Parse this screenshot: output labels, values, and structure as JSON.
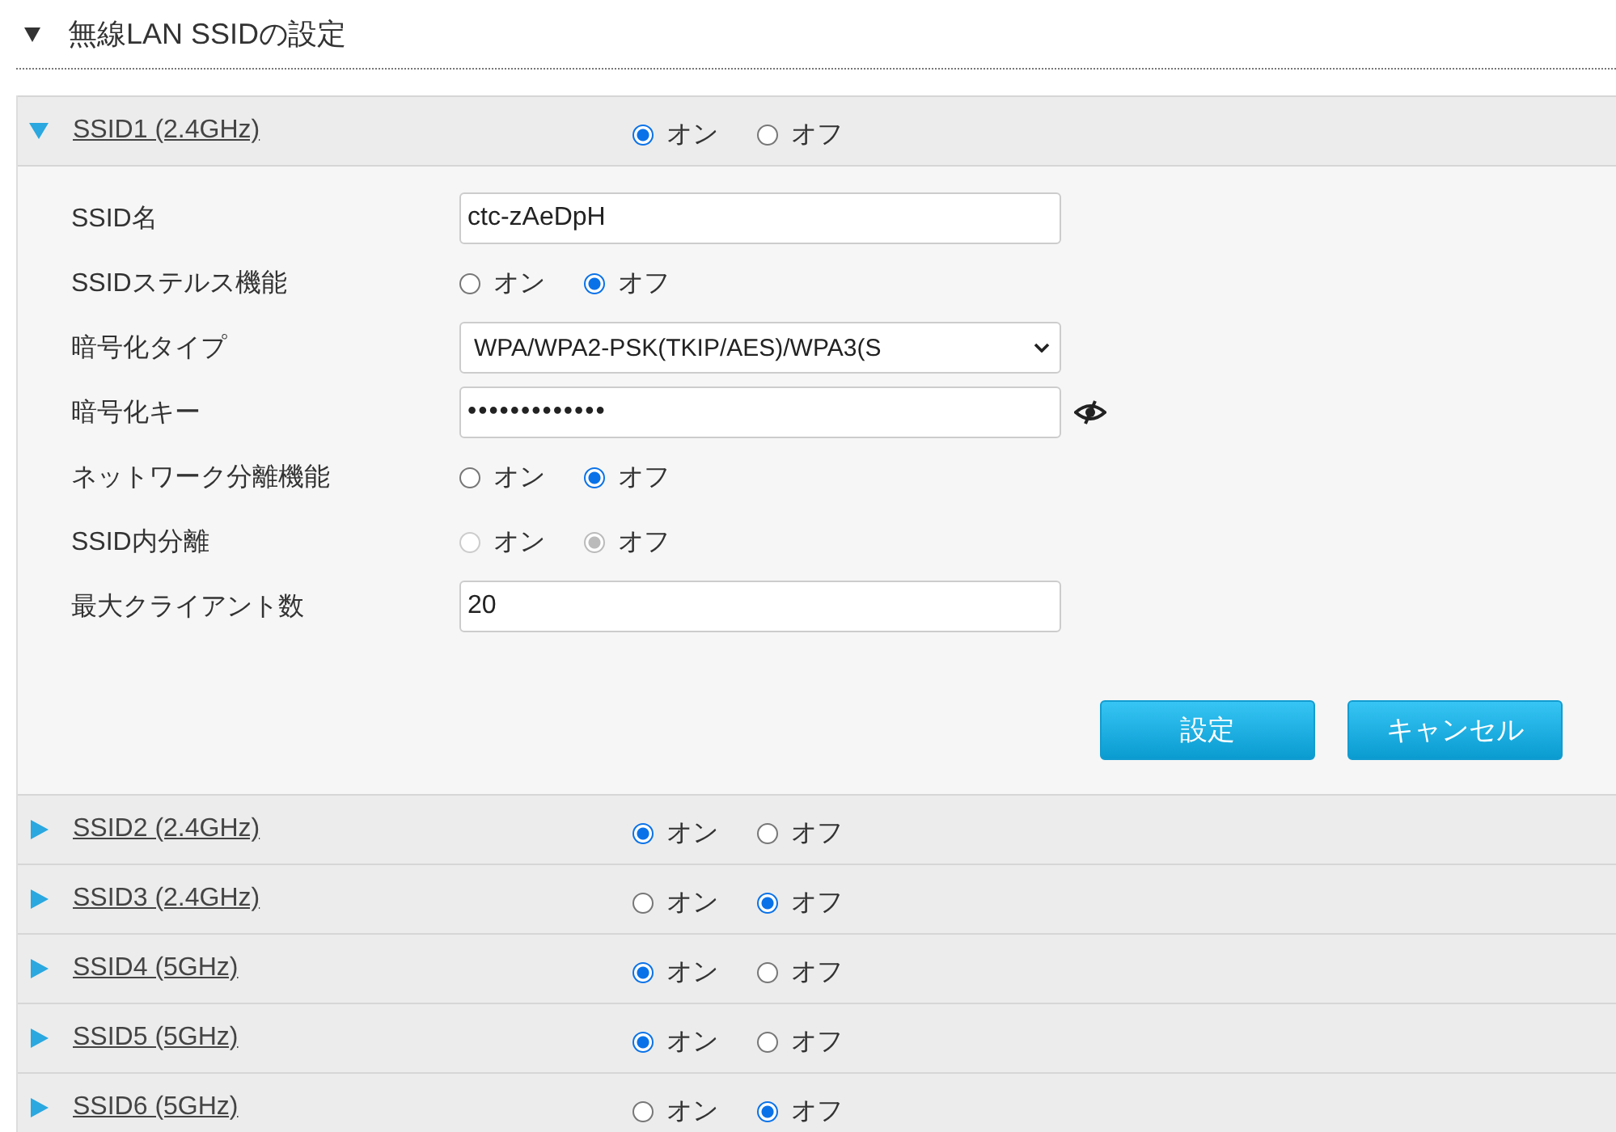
{
  "header": {
    "title": "無線LAN SSIDの設定",
    "expanded": true
  },
  "sections": [
    {
      "name": "SSID1 (2.4GHz)",
      "expanded": true,
      "options": [
        {
          "label": "オン",
          "selected": true
        },
        {
          "label": "オフ",
          "selected": false
        }
      ],
      "fields": [
        {
          "kind": "text",
          "label": "SSID名",
          "value": "ctc-zAeDpH"
        },
        {
          "kind": "radio",
          "label": "SSIDステルス機能",
          "disabled": false,
          "options": [
            {
              "label": "オン",
              "selected": false
            },
            {
              "label": "オフ",
              "selected": true
            }
          ]
        },
        {
          "kind": "select",
          "label": "暗号化タイプ",
          "value": "WPA/WPA2-PSK(TKIP/AES)/WPA3(S"
        },
        {
          "kind": "password",
          "label": "暗号化キー",
          "value": "•••••••••••••"
        },
        {
          "kind": "radio",
          "label": "ネットワーク分離機能",
          "disabled": false,
          "options": [
            {
              "label": "オン",
              "selected": false
            },
            {
              "label": "オフ",
              "selected": true
            }
          ]
        },
        {
          "kind": "radio",
          "label": "SSID内分離",
          "disabled": true,
          "options": [
            {
              "label": "オン",
              "selected": false
            },
            {
              "label": "オフ",
              "selected": true
            }
          ]
        },
        {
          "kind": "text",
          "label": "最大クライアント数",
          "value": "20"
        }
      ],
      "buttons": [
        "設定",
        "キャンセル"
      ]
    },
    {
      "name": "SSID2 (2.4GHz)",
      "expanded": false,
      "options": [
        {
          "label": "オン",
          "selected": true
        },
        {
          "label": "オフ",
          "selected": false
        }
      ]
    },
    {
      "name": "SSID3 (2.4GHz)",
      "expanded": false,
      "options": [
        {
          "label": "オン",
          "selected": false
        },
        {
          "label": "オフ",
          "selected": true
        }
      ]
    },
    {
      "name": "SSID4 (5GHz)",
      "expanded": false,
      "options": [
        {
          "label": "オン",
          "selected": true
        },
        {
          "label": "オフ",
          "selected": false
        }
      ]
    },
    {
      "name": "SSID5 (5GHz)",
      "expanded": false,
      "options": [
        {
          "label": "オン",
          "selected": true
        },
        {
          "label": "オフ",
          "selected": false
        }
      ]
    },
    {
      "name": "SSID6 (5GHz)",
      "expanded": false,
      "options": [
        {
          "label": "オン",
          "selected": false
        },
        {
          "label": "オフ",
          "selected": true
        }
      ]
    }
  ]
}
